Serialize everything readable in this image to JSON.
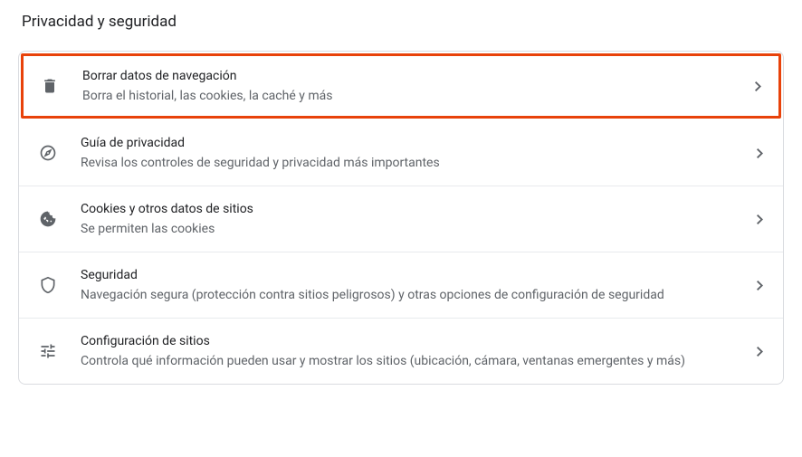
{
  "section_title": "Privacidad y seguridad",
  "rows": [
    {
      "icon": "trash-icon",
      "title": "Borrar datos de navegación",
      "desc": "Borra el historial, las cookies, la caché y más"
    },
    {
      "icon": "compass-icon",
      "title": "Guía de privacidad",
      "desc": "Revisa los controles de seguridad y privacidad más importantes"
    },
    {
      "icon": "cookie-icon",
      "title": "Cookies y otros datos de sitios",
      "desc": "Se permiten las cookies"
    },
    {
      "icon": "shield-icon",
      "title": "Seguridad",
      "desc": "Navegación segura (protección contra sitios peligrosos) y otras opciones de configuración de seguridad"
    },
    {
      "icon": "sliders-icon",
      "title": "Configuración de sitios",
      "desc": "Controla qué información pueden usar y mostrar los sitios (ubicación, cámara, ventanas emergentes y más)"
    }
  ]
}
